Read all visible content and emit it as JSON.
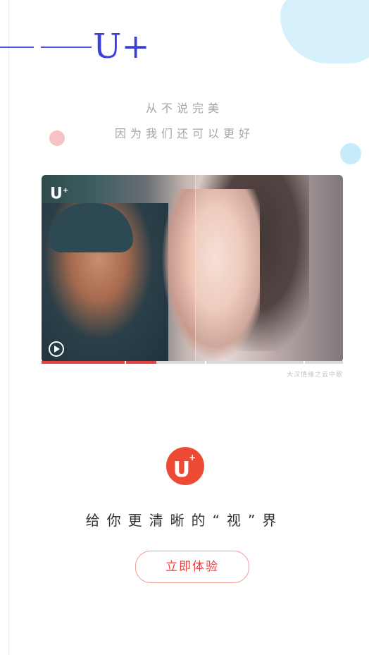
{
  "brand": {
    "text": "U+"
  },
  "tagline": {
    "line1": "从不说完美",
    "line2": "因为我们还可以更好"
  },
  "video": {
    "logo_text": "U",
    "logo_sup": "+",
    "progress": 0.38,
    "caption": "大汉情缘之云中歌"
  },
  "app_logo": {
    "text": "U",
    "sup": "+"
  },
  "slogan": "给你更清晰的“视”界",
  "cta": {
    "label": "立即体验"
  },
  "colors": {
    "brand_blue": "#3b41d4",
    "accent_red": "#e8413f",
    "logo_red": "#ec4a35",
    "bubble_blue": "#d6f1fb",
    "bubble_pink": "#f7c2c4"
  }
}
